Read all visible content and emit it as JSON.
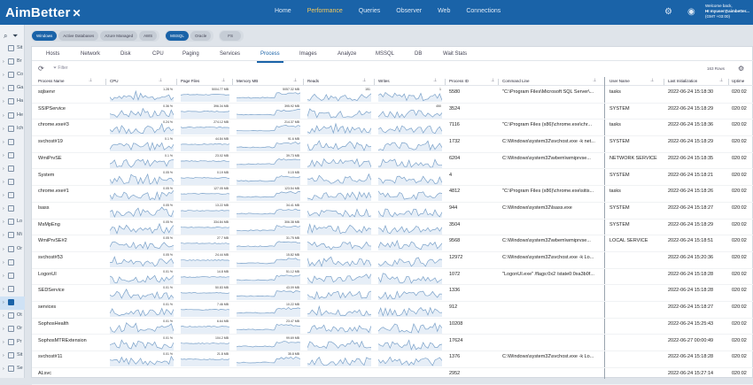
{
  "app": {
    "logo": "AimBetter",
    "user_line1": "Welcome back,",
    "user_line2": "HI myuser@aimbetter...",
    "user_line3": "(GMT +03:00)"
  },
  "nav": [
    "Home",
    "Performance",
    "Queries",
    "Observer",
    "Web",
    "Connections"
  ],
  "nav_active": "Performance",
  "icons": {
    "settings": "gear-icon",
    "user": "user-icon"
  },
  "sidebar": [
    {
      "label": "Sit",
      "arrow": ""
    },
    {
      "label": "Br",
      "arrow": "›"
    },
    {
      "label": "Co",
      "arrow": "›"
    },
    {
      "label": "Ga",
      "arrow": "›"
    },
    {
      "label": "Ha",
      "arrow": "›"
    },
    {
      "label": "He",
      "arrow": "›"
    },
    {
      "label": "Ich",
      "arrow": "›"
    },
    {
      "label": "",
      "arrow": "›"
    },
    {
      "label": "",
      "arrow": "›"
    },
    {
      "label": "",
      "arrow": "›"
    },
    {
      "label": "",
      "arrow": "›"
    },
    {
      "label": "",
      "arrow": "›"
    },
    {
      "label": "",
      "arrow": "›"
    },
    {
      "label": "Lo",
      "arrow": "›"
    },
    {
      "label": "Mi",
      "arrow": "›"
    },
    {
      "label": "Or",
      "arrow": "›"
    },
    {
      "label": "",
      "arrow": "›"
    },
    {
      "label": "",
      "arrow": "›"
    },
    {
      "label": "",
      "arrow": "›"
    },
    {
      "label": "",
      "arrow": "›"
    },
    {
      "label": "Ot",
      "arrow": "›"
    },
    {
      "label": "Or",
      "arrow": "›"
    },
    {
      "label": "Pr",
      "arrow": "›"
    },
    {
      "label": "Sit",
      "arrow": "›"
    },
    {
      "label": "Se",
      "arrow": "›"
    }
  ],
  "sidebar_selected": 19,
  "filters": {
    "env": [
      {
        "label": "Windows",
        "on": true
      },
      {
        "label": "Active Databases",
        "on": false
      },
      {
        "label": "Azure Managed",
        "on": false
      },
      {
        "label": "AWS",
        "on": false
      }
    ],
    "db": [
      {
        "label": "MSSQL",
        "on": true
      },
      {
        "label": "Oracle",
        "on": false
      }
    ],
    "fs": {
      "label": "FS",
      "on": false
    }
  },
  "tabs": [
    "Hosts",
    "Network",
    "Disk",
    "CPU",
    "Paging",
    "Services",
    "Process",
    "Images",
    "Analyze",
    "MSSQL",
    "DB",
    "Wait Stats"
  ],
  "tab_active": "Process",
  "toolbar": {
    "filter_placeholder": "Filter",
    "row_count": "163 Rows"
  },
  "columns": {
    "name": "Process Name",
    "cpu": "CPU",
    "page": "Page Files",
    "mem": "Memory MB",
    "reads": "Reads",
    "writes": "Writes",
    "pid": "Process ID",
    "cmd": "Command Line",
    "user": "User Name",
    "init": "Last Initialization",
    "uptime": "Uptime"
  },
  "rows": [
    {
      "name": "sqlservr",
      "cpu": "1.28 %",
      "page": "5004.77 MB",
      "mem": "5057.32 MB",
      "reads": "151",
      "writes": "1",
      "pid": "5580",
      "cmd": "\"C:\\Program Files\\Microsoft SQL Server\\...",
      "user": "tasks",
      "init": "2022-06-24 15:18:30",
      "up": "020:02"
    },
    {
      "name": "SSIPService",
      "cpu": "0.36 %",
      "page": "396.34 MB",
      "mem": "395.92 MB",
      "reads": "",
      "writes": "450",
      "pid": "3524",
      "cmd": "",
      "user": "SYSTEM",
      "init": "2022-06-24 15:18:29",
      "up": "020:02"
    },
    {
      "name": "chrome.exe#3",
      "cpu": "0.24 %",
      "page": "274.12 MB",
      "mem": "214.37 MB",
      "reads": "",
      "writes": "",
      "pid": "7116",
      "cmd": "\"C:\\Program Files (x86)\\chrome.exe\\chr...",
      "user": "tasks",
      "init": "2022-06-24 15:18:36",
      "up": "020:02"
    },
    {
      "name": "svchost#19",
      "cpu": "0.1 %",
      "page": "44.84 MB",
      "mem": "91.6 MB",
      "reads": "",
      "writes": "",
      "pid": "1732",
      "cmd": "C:\\Windows\\system32\\svchost.exe -k net...",
      "user": "SYSTEM",
      "init": "2022-06-24 15:18:29",
      "up": "020:02"
    },
    {
      "name": "WmiPrvSE",
      "cpu": "0.1 %",
      "page": "23.02 MB",
      "mem": "39.73 MB",
      "reads": "",
      "writes": "",
      "pid": "6204",
      "cmd": "C:\\Windows\\system32\\wbem\\wmiprvse...",
      "user": "NETWORK SERVICE",
      "init": "2022-06-24 15:18:35",
      "up": "020:02"
    },
    {
      "name": "System",
      "cpu": "0.05 %",
      "page": "0.19 MB",
      "mem": "0.15 MB",
      "reads": "",
      "writes": "",
      "pid": "4",
      "cmd": "",
      "user": "SYSTEM",
      "init": "2022-06-24 15:18:21",
      "up": "020:02"
    },
    {
      "name": "chrome.exe#1",
      "cpu": "0.05 %",
      "page": "127.05 MB",
      "mem": "123.54 MB",
      "reads": "",
      "writes": "",
      "pid": "4812",
      "cmd": "\"C:\\Program Files (x86)\\chrome.exe\\sitis...",
      "user": "tasks",
      "init": "2022-06-24 15:18:26",
      "up": "020:02"
    },
    {
      "name": "lsass",
      "cpu": "0.05 %",
      "page": "13.22 MB",
      "mem": "34.41 MB",
      "reads": "",
      "writes": "",
      "pid": "944",
      "cmd": "C:\\Windows\\system32\\lsass.exe",
      "user": "SYSTEM",
      "init": "2022-06-24 15:18:27",
      "up": "020:02"
    },
    {
      "name": "MsMpEng",
      "cpu": "0.05 %",
      "page": "334.84 MB",
      "mem": "306.38 MB",
      "reads": "",
      "writes": "",
      "pid": "3504",
      "cmd": "",
      "user": "SYSTEM",
      "init": "2022-06-24 15:18:29",
      "up": "020:02"
    },
    {
      "name": "WmiPrvSE#2",
      "cpu": "0.05 %",
      "page": "27.7 MB",
      "mem": "31.75 MB",
      "reads": "",
      "writes": "",
      "pid": "9568",
      "cmd": "C:\\Windows\\system32\\wbem\\wmiprvse...",
      "user": "LOCAL SERVICE",
      "init": "2022-06-24 15:18:51",
      "up": "020:02"
    },
    {
      "name": "svchost#53",
      "cpu": "0.05 %",
      "page": "24.44 MB",
      "mem": "15.82 MB",
      "reads": "",
      "writes": "",
      "pid": "12972",
      "cmd": "C:\\Windows\\system32\\svchost.exe -k Lo...",
      "user": "",
      "init": "2022-06-24 15:20:36",
      "up": "020:02"
    },
    {
      "name": "LogonUI",
      "cpu": "0.01 %",
      "page": "14.8 MB",
      "mem": "51.12 MB",
      "reads": "",
      "writes": "",
      "pid": "1072",
      "cmd": "\"LogonUI.exe\" /flags:0x2 /state0:0xa3b0f...",
      "user": "",
      "init": "2022-06-24 15:18:28",
      "up": "020:02"
    },
    {
      "name": "SEDService",
      "cpu": "0.01 %",
      "page": "50.83 MB",
      "mem": "43.09 MB",
      "reads": "",
      "writes": "",
      "pid": "1336",
      "cmd": "",
      "user": "",
      "init": "2022-06-24 15:18:28",
      "up": "020:02"
    },
    {
      "name": "services",
      "cpu": "0.01 %",
      "page": "7.46 MB",
      "mem": "10.22 MB",
      "reads": "",
      "writes": "",
      "pid": "912",
      "cmd": "",
      "user": "",
      "init": "2022-06-24 15:18:27",
      "up": "020:02"
    },
    {
      "name": "SophosHealth",
      "cpu": "0.01 %",
      "page": "6.64 MB",
      "mem": "23.47 MB",
      "reads": "",
      "writes": "",
      "pid": "10208",
      "cmd": "",
      "user": "",
      "init": "2022-06-24 15:25:43",
      "up": "020:02"
    },
    {
      "name": "SophosMTRExtension",
      "cpu": "0.01 %",
      "page": "104.2 MB",
      "mem": "99.69 MB",
      "reads": "",
      "writes": "",
      "pid": "17624",
      "cmd": "",
      "user": "",
      "init": "2022-06-27 00:00:49",
      "up": "020:02"
    },
    {
      "name": "svchost#11",
      "cpu": "0.01 %",
      "page": "21.8 MB",
      "mem": "35.8 MB",
      "reads": "",
      "writes": "",
      "pid": "1376",
      "cmd": "C:\\Windows\\system32\\svchost.exe -k Lo...",
      "user": "",
      "init": "2022-06-24 15:18:28",
      "up": "020:02"
    },
    {
      "name": "ALsvc",
      "cpu": "",
      "page": "",
      "mem": "",
      "reads": "",
      "writes": "",
      "pid": "2952",
      "cmd": "",
      "user": "",
      "init": "2022-06-24 15:27:14",
      "up": "020:02"
    }
  ]
}
